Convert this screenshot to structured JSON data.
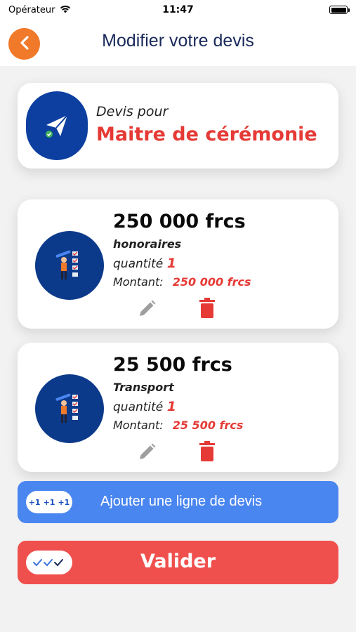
{
  "status_bar": {
    "carrier": "Opérateur",
    "time": "11:47",
    "icons": [
      "wifi-icon",
      "battery-icon"
    ]
  },
  "navbar": {
    "back_icon": "chevron-left-icon",
    "title": "Modifier votre devis"
  },
  "header_card": {
    "icon": "paper-plane-icon",
    "label": "Devis pour",
    "service": "Maitre de cérémonie"
  },
  "lines": [
    {
      "amount": "250 000 frcs",
      "name": "honoraires",
      "quantity_label": "quantité",
      "quantity": "1",
      "montant_label": "Montant:",
      "montant": "250 000 frcs",
      "icon": "worker-checklist-icon",
      "edit_icon": "pencil-icon",
      "delete_icon": "trash-icon"
    },
    {
      "amount": "25 500 frcs",
      "name": "Transport",
      "quantity_label": "quantité",
      "quantity": "1",
      "montant_label": "Montant:",
      "montant": "25 500 frcs",
      "icon": "worker-checklist-icon",
      "edit_icon": "pencil-icon",
      "delete_icon": "trash-icon"
    }
  ],
  "add_button": {
    "badge": [
      "+1",
      "+1",
      "+1"
    ],
    "label": "Ajouter une ligne de devis"
  },
  "validate_button": {
    "icon": "triple-check-icon",
    "label": "Valider"
  },
  "colors": {
    "accent_orange": "#f07a2a",
    "title_navy": "#1a2a5a",
    "red": "#e53a35",
    "blue_button": "#4a86f0",
    "red_button": "#f0504d",
    "avatar_blue": "#0c3fa0"
  }
}
